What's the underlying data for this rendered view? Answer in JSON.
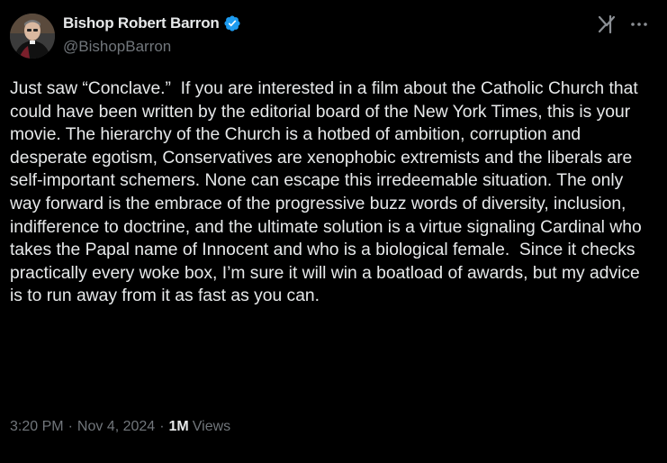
{
  "author": {
    "display_name": "Bishop Robert Barron",
    "handle": "@BishopBarron",
    "verified": true,
    "verified_color": "#1d9bf0"
  },
  "icons": {
    "avatar": "profile-photo",
    "verified": "verified-badge-icon",
    "grok": "grok-icon",
    "more": "more-options-icon"
  },
  "tweet": {
    "text": "Just saw “Conclave.”  If you are interested in a film about the Catholic Church that could have been written by the editorial board of the New York Times, this is your movie. The hierarchy of the Church is a hotbed of ambition, corruption and desperate egotism, Conservatives are xenophobic extremists and the liberals are self-important schemers. None can escape this irredeemable situation. The only way forward is the embrace of the progressive buzz words of diversity, inclusion, indifference to doctrine, and the ultimate solution is a virtue signaling Cardinal who takes the Papal name of Innocent and who is a biological female.  Since it checks practically every woke box, I’m sure it will win a boatload of awards, but my advice is to run away from it as fast as you can."
  },
  "meta": {
    "time": "3:20 PM",
    "separator": "·",
    "date": "Nov 4, 2024",
    "views_count": "1M",
    "views_label": "Views"
  },
  "colors": {
    "background": "#000000",
    "text_primary": "#e7e9ea",
    "text_secondary": "#71767b"
  }
}
